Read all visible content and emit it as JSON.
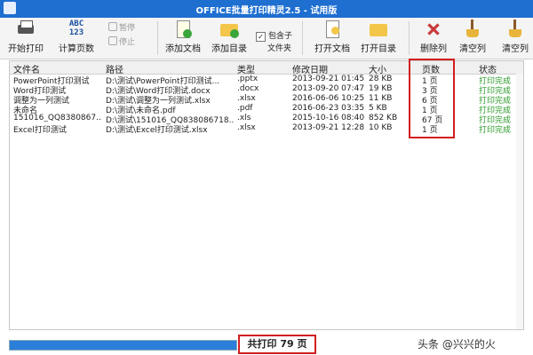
{
  "window": {
    "title": "OFFICE批量打印精灵2.5 - 试用版"
  },
  "toolbar": {
    "start_print": "开始打印",
    "count_pages": "计算页数",
    "pause": "暂停",
    "stop": "停止",
    "add_docs": "添加文档",
    "add_dir": "添加目录",
    "include_subdirs_line1": "包含子",
    "include_subdirs_line2": "文件夹",
    "open_doc": "打开文档",
    "open_dir": "打开目录",
    "delete_col": "删除列",
    "clear_list": "清空列",
    "clear_all": "清空列",
    "abc_icon_text": "ABC",
    "abc_icon_num": "123",
    "dropdown_glyph": "▼",
    "check_mark": "✓"
  },
  "table": {
    "columns": [
      "文件名",
      "路径",
      "类型",
      "修改日期",
      "大小",
      "页数",
      "状态"
    ],
    "rows": [
      {
        "name": "PowerPoint打印测试",
        "path": "D:\\测试\\PowerPoint打印测试...",
        "type": ".pptx",
        "date": "2013-09-21 01:45",
        "size": "28 KB",
        "pages": "1 页",
        "status": "打印完成"
      },
      {
        "name": "Word打印测试",
        "path": "D:\\测试\\Word打印测试.docx",
        "type": ".docx",
        "date": "2013-09-20 07:47",
        "size": "19 KB",
        "pages": "3 页",
        "status": "打印完成"
      },
      {
        "name": "调整为一列测试",
        "path": "D:\\测试\\调整为一列测试.xlsx",
        "type": ".xlsx",
        "date": "2016-06-06 10:25",
        "size": "11 KB",
        "pages": "6 页",
        "status": "打印完成"
      },
      {
        "name": "未命名",
        "path": "D:\\测试\\未命名.pdf",
        "type": ".pdf",
        "date": "2016-06-23 03:35",
        "size": "5 KB",
        "pages": "1 页",
        "status": "打印完成"
      },
      {
        "name": "151016_QQ8380867...",
        "path": "D:\\测试\\151016_QQ838086718...",
        "type": ".xls",
        "date": "2015-10-16 08:40",
        "size": "852 KB",
        "pages": "67 页",
        "status": "打印完成"
      },
      {
        "name": "Excel打印测试",
        "path": "D:\\测试\\Excel打印测试.xlsx",
        "type": ".xlsx",
        "date": "2013-09-21 12:28",
        "size": "10 KB",
        "pages": "1 页",
        "status": "打印完成"
      }
    ]
  },
  "footer": {
    "progress": 1.0,
    "total_label": "共打印 79 页",
    "watermark": "头条 @兴兴的火"
  },
  "colors": {
    "titlebar": "#1f6fd0",
    "highlight": "#d21e1e",
    "status_ok": "#2a9a2a",
    "progress": "#2b7fd8"
  }
}
